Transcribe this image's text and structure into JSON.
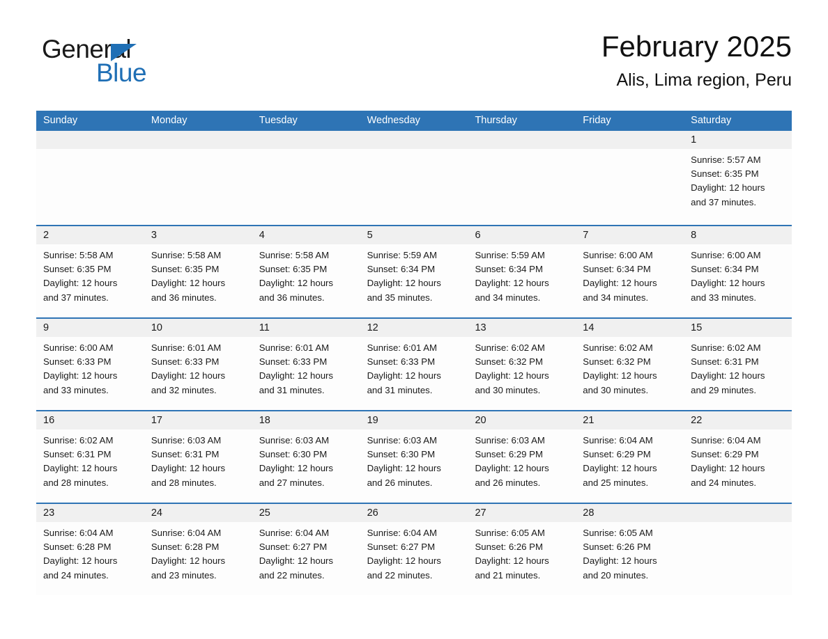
{
  "brand": {
    "name_part1": "General",
    "name_part2": "Blue",
    "triangle_icon": "triangle-icon",
    "accent_color": "#1f6fb5"
  },
  "header": {
    "month_title": "February 2025",
    "location": "Alis, Lima region, Peru"
  },
  "theme": {
    "header_blue": "#2e74b5",
    "row_divider_blue": "#2e74b5",
    "day_band_gray": "#f0f0f0",
    "text_color": "#1a1a1a"
  },
  "calendar": {
    "weekday_headers": [
      "Sunday",
      "Monday",
      "Tuesday",
      "Wednesday",
      "Thursday",
      "Friday",
      "Saturday"
    ],
    "weeks": [
      [
        {
          "day": "",
          "sunrise": "",
          "sunset": "",
          "daylight": "",
          "daylight2": ""
        },
        {
          "day": "",
          "sunrise": "",
          "sunset": "",
          "daylight": "",
          "daylight2": ""
        },
        {
          "day": "",
          "sunrise": "",
          "sunset": "",
          "daylight": "",
          "daylight2": ""
        },
        {
          "day": "",
          "sunrise": "",
          "sunset": "",
          "daylight": "",
          "daylight2": ""
        },
        {
          "day": "",
          "sunrise": "",
          "sunset": "",
          "daylight": "",
          "daylight2": ""
        },
        {
          "day": "",
          "sunrise": "",
          "sunset": "",
          "daylight": "",
          "daylight2": ""
        },
        {
          "day": "1",
          "sunrise": "Sunrise: 5:57 AM",
          "sunset": "Sunset: 6:35 PM",
          "daylight": "Daylight: 12 hours",
          "daylight2": "and 37 minutes."
        }
      ],
      [
        {
          "day": "2",
          "sunrise": "Sunrise: 5:58 AM",
          "sunset": "Sunset: 6:35 PM",
          "daylight": "Daylight: 12 hours",
          "daylight2": "and 37 minutes."
        },
        {
          "day": "3",
          "sunrise": "Sunrise: 5:58 AM",
          "sunset": "Sunset: 6:35 PM",
          "daylight": "Daylight: 12 hours",
          "daylight2": "and 36 minutes."
        },
        {
          "day": "4",
          "sunrise": "Sunrise: 5:58 AM",
          "sunset": "Sunset: 6:35 PM",
          "daylight": "Daylight: 12 hours",
          "daylight2": "and 36 minutes."
        },
        {
          "day": "5",
          "sunrise": "Sunrise: 5:59 AM",
          "sunset": "Sunset: 6:34 PM",
          "daylight": "Daylight: 12 hours",
          "daylight2": "and 35 minutes."
        },
        {
          "day": "6",
          "sunrise": "Sunrise: 5:59 AM",
          "sunset": "Sunset: 6:34 PM",
          "daylight": "Daylight: 12 hours",
          "daylight2": "and 34 minutes."
        },
        {
          "day": "7",
          "sunrise": "Sunrise: 6:00 AM",
          "sunset": "Sunset: 6:34 PM",
          "daylight": "Daylight: 12 hours",
          "daylight2": "and 34 minutes."
        },
        {
          "day": "8",
          "sunrise": "Sunrise: 6:00 AM",
          "sunset": "Sunset: 6:34 PM",
          "daylight": "Daylight: 12 hours",
          "daylight2": "and 33 minutes."
        }
      ],
      [
        {
          "day": "9",
          "sunrise": "Sunrise: 6:00 AM",
          "sunset": "Sunset: 6:33 PM",
          "daylight": "Daylight: 12 hours",
          "daylight2": "and 33 minutes."
        },
        {
          "day": "10",
          "sunrise": "Sunrise: 6:01 AM",
          "sunset": "Sunset: 6:33 PM",
          "daylight": "Daylight: 12 hours",
          "daylight2": "and 32 minutes."
        },
        {
          "day": "11",
          "sunrise": "Sunrise: 6:01 AM",
          "sunset": "Sunset: 6:33 PM",
          "daylight": "Daylight: 12 hours",
          "daylight2": "and 31 minutes."
        },
        {
          "day": "12",
          "sunrise": "Sunrise: 6:01 AM",
          "sunset": "Sunset: 6:33 PM",
          "daylight": "Daylight: 12 hours",
          "daylight2": "and 31 minutes."
        },
        {
          "day": "13",
          "sunrise": "Sunrise: 6:02 AM",
          "sunset": "Sunset: 6:32 PM",
          "daylight": "Daylight: 12 hours",
          "daylight2": "and 30 minutes."
        },
        {
          "day": "14",
          "sunrise": "Sunrise: 6:02 AM",
          "sunset": "Sunset: 6:32 PM",
          "daylight": "Daylight: 12 hours",
          "daylight2": "and 30 minutes."
        },
        {
          "day": "15",
          "sunrise": "Sunrise: 6:02 AM",
          "sunset": "Sunset: 6:31 PM",
          "daylight": "Daylight: 12 hours",
          "daylight2": "and 29 minutes."
        }
      ],
      [
        {
          "day": "16",
          "sunrise": "Sunrise: 6:02 AM",
          "sunset": "Sunset: 6:31 PM",
          "daylight": "Daylight: 12 hours",
          "daylight2": "and 28 minutes."
        },
        {
          "day": "17",
          "sunrise": "Sunrise: 6:03 AM",
          "sunset": "Sunset: 6:31 PM",
          "daylight": "Daylight: 12 hours",
          "daylight2": "and 28 minutes."
        },
        {
          "day": "18",
          "sunrise": "Sunrise: 6:03 AM",
          "sunset": "Sunset: 6:30 PM",
          "daylight": "Daylight: 12 hours",
          "daylight2": "and 27 minutes."
        },
        {
          "day": "19",
          "sunrise": "Sunrise: 6:03 AM",
          "sunset": "Sunset: 6:30 PM",
          "daylight": "Daylight: 12 hours",
          "daylight2": "and 26 minutes."
        },
        {
          "day": "20",
          "sunrise": "Sunrise: 6:03 AM",
          "sunset": "Sunset: 6:29 PM",
          "daylight": "Daylight: 12 hours",
          "daylight2": "and 26 minutes."
        },
        {
          "day": "21",
          "sunrise": "Sunrise: 6:04 AM",
          "sunset": "Sunset: 6:29 PM",
          "daylight": "Daylight: 12 hours",
          "daylight2": "and 25 minutes."
        },
        {
          "day": "22",
          "sunrise": "Sunrise: 6:04 AM",
          "sunset": "Sunset: 6:29 PM",
          "daylight": "Daylight: 12 hours",
          "daylight2": "and 24 minutes."
        }
      ],
      [
        {
          "day": "23",
          "sunrise": "Sunrise: 6:04 AM",
          "sunset": "Sunset: 6:28 PM",
          "daylight": "Daylight: 12 hours",
          "daylight2": "and 24 minutes."
        },
        {
          "day": "24",
          "sunrise": "Sunrise: 6:04 AM",
          "sunset": "Sunset: 6:28 PM",
          "daylight": "Daylight: 12 hours",
          "daylight2": "and 23 minutes."
        },
        {
          "day": "25",
          "sunrise": "Sunrise: 6:04 AM",
          "sunset": "Sunset: 6:27 PM",
          "daylight": "Daylight: 12 hours",
          "daylight2": "and 22 minutes."
        },
        {
          "day": "26",
          "sunrise": "Sunrise: 6:04 AM",
          "sunset": "Sunset: 6:27 PM",
          "daylight": "Daylight: 12 hours",
          "daylight2": "and 22 minutes."
        },
        {
          "day": "27",
          "sunrise": "Sunrise: 6:05 AM",
          "sunset": "Sunset: 6:26 PM",
          "daylight": "Daylight: 12 hours",
          "daylight2": "and 21 minutes."
        },
        {
          "day": "28",
          "sunrise": "Sunrise: 6:05 AM",
          "sunset": "Sunset: 6:26 PM",
          "daylight": "Daylight: 12 hours",
          "daylight2": "and 20 minutes."
        },
        {
          "day": "",
          "sunrise": "",
          "sunset": "",
          "daylight": "",
          "daylight2": ""
        }
      ]
    ]
  }
}
